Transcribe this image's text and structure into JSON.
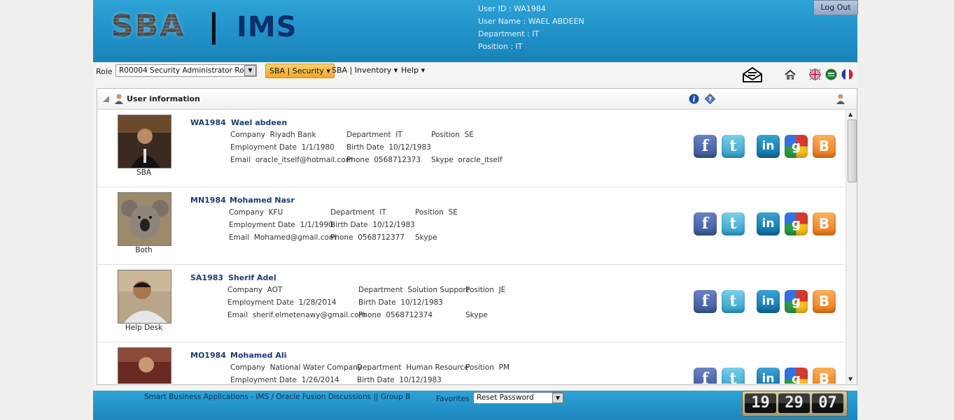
{
  "header": {
    "logo_sba": "SBA",
    "logo_sep": "|",
    "logo_ims": "IMS",
    "user_id": "User ID : WA1984",
    "user_name": "User Name : WAEL ABDEEN",
    "department": "Department : IT",
    "position": "Position : IT",
    "logout": "Log Out"
  },
  "menubar": {
    "role_label": "Role",
    "role_value": "R00004 Security Administrator Role",
    "menus": [
      "SBA | Security ▾",
      "SBA | Inventory ▾",
      "Help ▾"
    ]
  },
  "panel": {
    "title": "User information"
  },
  "users": [
    {
      "id": "WA1984",
      "name": "Wael abdeen",
      "caption": "SBA",
      "company_label": "Company",
      "company": "Riyadh Bank",
      "department_label": "Department",
      "department": "IT",
      "position_label": "Position",
      "position": "SE",
      "employment_label": "Employment Date",
      "employment": "1/1/1980",
      "birth_label": "Birth Date",
      "birth": "10/12/1983",
      "email_label": "Email",
      "email": "oracle_itself@hotmail.com",
      "phone_label": "Phone",
      "phone": "0568712373",
      "skype_label": "Skype",
      "skype": "oracle_itself"
    },
    {
      "id": "MN1984",
      "name": "Mohamed Nasr",
      "caption": "Both",
      "company_label": "Company",
      "company": "KFU",
      "department_label": "Department",
      "department": "IT",
      "position_label": "Position",
      "position": "SE",
      "employment_label": "Employment Date",
      "employment": "1/1/1990",
      "birth_label": "Birth Date",
      "birth": "10/12/1983",
      "email_label": "Email",
      "email": "Mohamed@gmail.com",
      "phone_label": "Phone",
      "phone": "0568712377",
      "skype_label": "Skype",
      "skype": ""
    },
    {
      "id": "SA1983",
      "name": "Sherif Adel",
      "caption": "Help Desk",
      "company_label": "Company",
      "company": "AOT",
      "department_label": "Department",
      "department": "Solution Support",
      "position_label": "Position",
      "position": "JE",
      "employment_label": "Employment Date",
      "employment": "1/28/2014",
      "birth_label": "Birth Date",
      "birth": "10/12/1983",
      "email_label": "Email",
      "email": "sherif.elmetenawy@gmail.com",
      "phone_label": "Phone",
      "phone": "0568712374",
      "skype_label": "Skype",
      "skype": ""
    },
    {
      "id": "MO1984",
      "name": "Mohamed Ali",
      "caption": "",
      "company_label": "Company",
      "company": "National Water Company",
      "department_label": "Department",
      "department": "Human Resource",
      "position_label": "Position",
      "position": "PM",
      "employment_label": "Employment Date",
      "employment": "1/26/2014",
      "birth_label": "Birth Date",
      "birth": "10/12/1983",
      "email_label": "",
      "email": "",
      "phone_label": "",
      "phone": "",
      "skype_label": "",
      "skype": ""
    }
  ],
  "social_icons": [
    "facebook-icon",
    "twitter-icon",
    "linkedin-icon",
    "google-plus-icon",
    "blogger-icon"
  ],
  "footer": {
    "text": "Smart Business Applications - IMS / Oracle Fusion Discussions || Group B",
    "favorites_label": "Favorites",
    "favorites_value": "Reset Password",
    "clock_h": "19",
    "clock_m": "29",
    "clock_s": "07"
  }
}
